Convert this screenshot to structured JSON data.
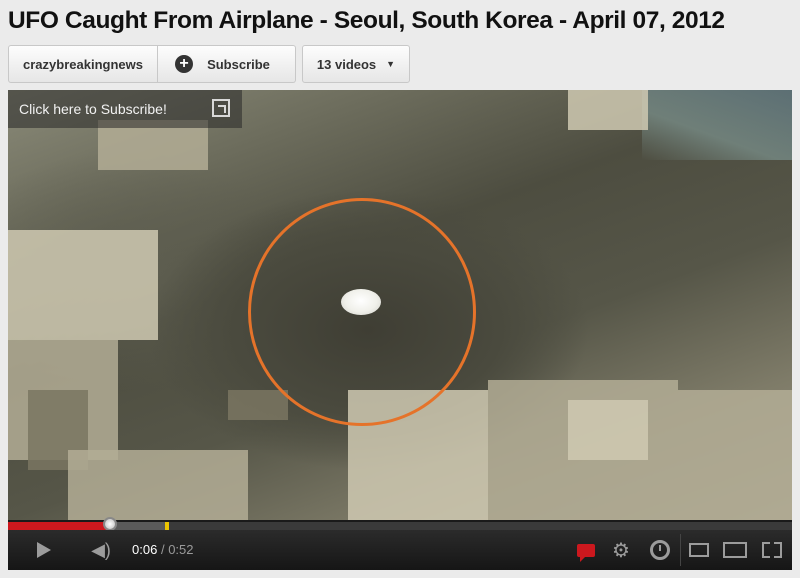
{
  "video": {
    "title": "UFO Caught From Airplane - Seoul, South Korea - April 07, 2012"
  },
  "buttons": {
    "channel_label": "crazybreakingnews",
    "subscribe_plus": "+",
    "subscribe_label": "Subscribe",
    "videos_label": "13 videos",
    "videos_caret": "▼"
  },
  "overlay": {
    "subscribe_prompt": "Click here to Subscribe!"
  },
  "player": {
    "current_time": "0:06",
    "time_separator": "/",
    "duration": "0:52",
    "progress_fraction": 0.13,
    "buffered_fraction": 0.2
  },
  "icons": {
    "play": "play-icon",
    "volume": "volume-icon",
    "captions": "captions-icon",
    "settings": "gear-icon",
    "watch_later": "clock-icon",
    "small_player": "small-player-icon",
    "large_player": "large-player-icon",
    "fullscreen": "fullscreen-icon",
    "popout": "popout-icon"
  },
  "colors": {
    "progress_red": "#cc181e",
    "annotation_orange": "#e5732a",
    "ad_marker_yellow": "#ecc400"
  }
}
